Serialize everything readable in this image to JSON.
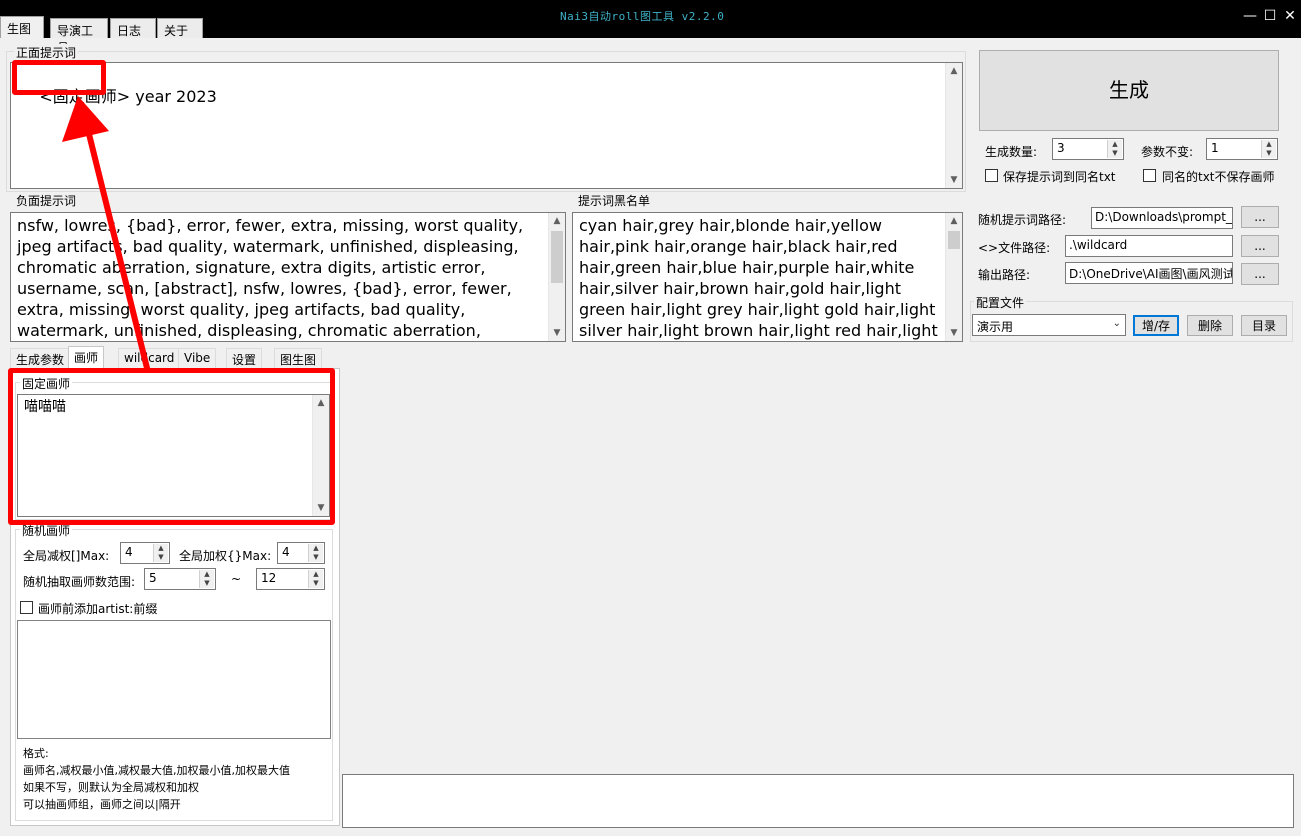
{
  "window": {
    "title": "Nai3自动roll图工具 v2.2.0",
    "controls": {
      "minimize": "—",
      "maximize": "☐",
      "close": "✕"
    }
  },
  "top_tabs": [
    "生图",
    "导演工具",
    "日志",
    "关于"
  ],
  "positive": {
    "label": "正面提示词",
    "highlight": "<固定画师>",
    "rest": " year 2023"
  },
  "generate": {
    "label": "生成"
  },
  "params": {
    "count_label": "生成数量:",
    "count_value": "3",
    "fixed_label": "参数不变:",
    "fixed_value": "1",
    "save_prompt_label": "保存提示词到同名txt",
    "save_prompt_checked": false,
    "no_artist_label": "同名的txt不保存画师",
    "no_artist_checked": false
  },
  "negative": {
    "label": "负面提示词",
    "text": "nsfw, lowres, {bad}, error, fewer, extra, missing, worst quality, jpeg artifacts, bad quality, watermark, unfinished, displeasing, chromatic aberration, signature, extra digits, artistic error, username, scan, [abstract], nsfw, lowres, {bad}, error, fewer, extra, missing, worst quality, jpeg artifacts, bad quality, watermark, unfinished, displeasing, chromatic aberration, signature, extra digits, artistic"
  },
  "blacklist": {
    "label": "提示词黑名单",
    "text": "cyan hair,grey hair,blonde hair,yellow hair,pink hair,orange hair,black hair,red hair,green hair,blue hair,purple hair,white hair,silver hair,brown hair,gold hair,light green hair,light grey hair,light gold hair,light silver hair,light brown hair,light red hair,light yellow hair,light"
  },
  "paths": {
    "random_label": "随机提示词路径:",
    "random_value": "D:\\Downloads\\prompt_",
    "wildcard_label": "<>文件路径:",
    "wildcard_value": ".\\wildcard",
    "output_label": "输出路径:",
    "output_value": "D:\\OneDrive\\AI画图\\画风测试",
    "browse_label": "..."
  },
  "config": {
    "label": "配置文件",
    "selected": "演示用",
    "add_save": "增/存",
    "delete": "删除",
    "directory": "目录"
  },
  "sub_tabs": [
    "生成参数",
    "画师",
    "wildcard",
    "Vibe",
    "设置",
    "图生图"
  ],
  "fixed_artist": {
    "label": "固定画师",
    "text": "喵喵喵"
  },
  "random_artist": {
    "label": "随机画师",
    "reduce_label": "全局减权[]Max:",
    "reduce_value": "4",
    "add_label": "全局加权{}Max:",
    "add_value": "4",
    "range_label": "随机抽取画师数范围:",
    "range_min": "5",
    "range_sep": "~",
    "range_max": "12",
    "prefix_label": "画师前添加artist:前缀",
    "prefix_checked": false,
    "format_lines": [
      "格式:",
      "画师名,减权最小值,减权最大值,加权最小值,加权最大值",
      "如果不写，则默认为全局减权和加权",
      "可以抽画师组，画师之间以|隔开"
    ]
  },
  "colors": {
    "annotation": "#ff0000",
    "titlebar": "#000000",
    "title_text": "#3fb2c8"
  }
}
